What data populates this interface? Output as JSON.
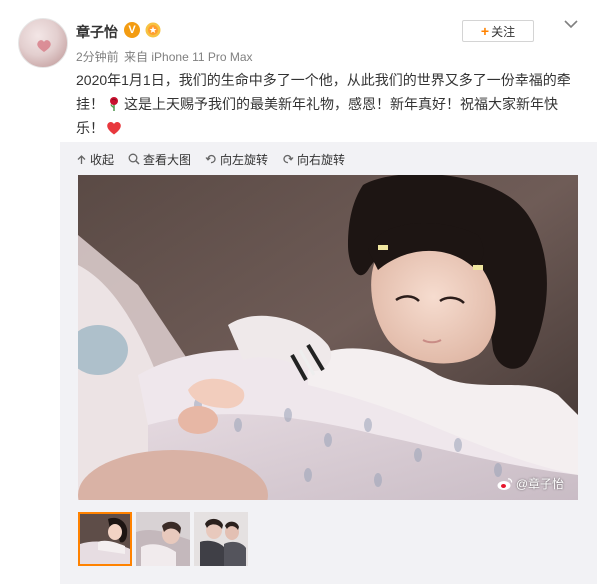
{
  "post": {
    "username": "章子怡",
    "verified_badge": "V",
    "time": "2分钟前",
    "from_label": "来自",
    "device": "iPhone 11 Pro Max",
    "text_part1": "2020年1月1日，我们的生命中多了一个他，从此我们的世界又多了一份幸福的牵挂！",
    "text_part2": "这是上天赐予我们的最美新年礼物，感恩！新年真好！祝福大家新年快乐！"
  },
  "actions": {
    "follow_label": "关注"
  },
  "toolbar": {
    "collapse": "收起",
    "view_large": "查看大图",
    "rotate_left": "向左旋转",
    "rotate_right": "向右旋转"
  },
  "media": {
    "watermark": "@章子怡",
    "thumbnail_count": 3
  },
  "colors": {
    "accent": "#ff8200",
    "text": "#333333",
    "meta": "#808080",
    "media_bg": "#f2f2f5"
  },
  "icons": [
    "avatar",
    "verified-icon",
    "medal-icon",
    "more-chevron-icon",
    "rose-icon",
    "heart-icon",
    "collapse-icon",
    "zoom-icon",
    "rotate-left-icon",
    "rotate-right-icon",
    "weibo-icon"
  ]
}
